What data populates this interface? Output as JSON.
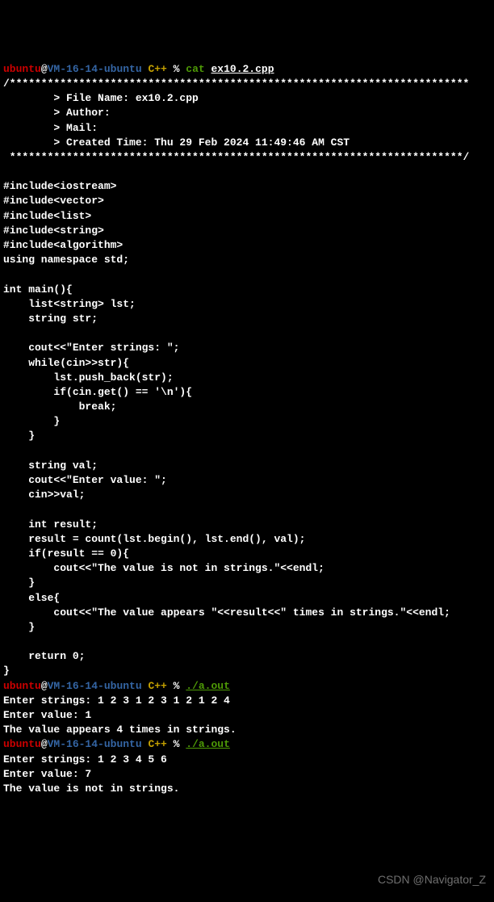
{
  "prompt1": {
    "user": "ubuntu",
    "at": "@",
    "host": "VM-16-14-ubuntu",
    "path": " C++ ",
    "pct": "% ",
    "cmd": "cat ",
    "arg": "ex10.2.cpp"
  },
  "code": {
    "l01": "/*************************************************************************",
    "l02": "        > File Name: ex10.2.cpp",
    "l03": "        > Author:",
    "l04": "        > Mail:",
    "l05": "        > Created Time: Thu 29 Feb 2024 11:49:46 AM CST",
    "l06": " ************************************************************************/",
    "l07": "",
    "l08": "#include<iostream>",
    "l09": "#include<vector>",
    "l10": "#include<list>",
    "l11": "#include<string>",
    "l12": "#include<algorithm>",
    "l13": "using namespace std;",
    "l14": "",
    "l15": "int main(){",
    "l16": "    list<string> lst;",
    "l17": "    string str;",
    "l18": "",
    "l19": "    cout<<\"Enter strings: \";",
    "l20": "    while(cin>>str){",
    "l21": "        lst.push_back(str);",
    "l22": "        if(cin.get() == '\\n'){",
    "l23": "            break;",
    "l24": "        }",
    "l25": "    }",
    "l26": "",
    "l27": "    string val;",
    "l28": "    cout<<\"Enter value: \";",
    "l29": "    cin>>val;",
    "l30": "",
    "l31": "    int result;",
    "l32": "    result = count(lst.begin(), lst.end(), val);",
    "l33": "    if(result == 0){",
    "l34": "        cout<<\"The value is not in strings.\"<<endl;",
    "l35": "    }",
    "l36": "    else{",
    "l37": "        cout<<\"The value appears \"<<result<<\" times in strings.\"<<endl;",
    "l38": "    }",
    "l39": "",
    "l40": "    return 0;",
    "l41": "}"
  },
  "prompt2": {
    "user": "ubuntu",
    "at": "@",
    "host": "VM-16-14-ubuntu",
    "path": " C++ ",
    "pct": "% ",
    "arg": "./a.out"
  },
  "run1": {
    "l1": "Enter strings: 1 2 3 1 2 3 1 2 1 2 4",
    "l2": "Enter value: 1",
    "l3": "The value appears 4 times in strings."
  },
  "prompt3": {
    "user": "ubuntu",
    "at": "@",
    "host": "VM-16-14-ubuntu",
    "path": " C++ ",
    "pct": "% ",
    "arg": "./a.out"
  },
  "run2": {
    "l1": "Enter strings: 1 2 3 4 5 6",
    "l2": "Enter value: 7",
    "l3": "The value is not in strings."
  },
  "watermark": "CSDN @Navigator_Z"
}
